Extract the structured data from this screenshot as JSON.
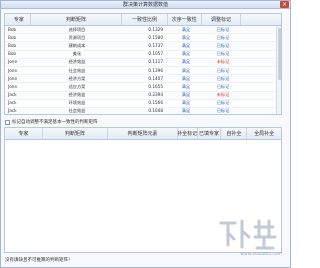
{
  "window": {
    "title": "群决策计算数据数值",
    "close_symbol": "×"
  },
  "grid1": {
    "headers": [
      "专家",
      "判断矩阵",
      "一致性比例",
      "次序一致性",
      "调整标记"
    ],
    "rows": [
      {
        "expert": "Bob",
        "matrix": "选择项目",
        "ratio": "0.1329",
        "order": "满足",
        "mark": "已标记"
      },
      {
        "expert": "Bob",
        "matrix": "资源项目",
        "ratio": "0.1580",
        "order": "满足",
        "mark": "已标记"
      },
      {
        "expert": "Bob",
        "matrix": "建筑成本",
        "ratio": "0.1737",
        "order": "满足",
        "mark": "已标记"
      },
      {
        "expert": "Bob",
        "matrix": "美化",
        "ratio": "0.1057",
        "order": "满足",
        "mark": "已标记"
      },
      {
        "expert": "Jone",
        "matrix": "经济效益",
        "ratio": "0.1117",
        "order": "满足",
        "mark": "未标记"
      },
      {
        "expert": "Jone",
        "matrix": "社会效益",
        "ratio": "0.1396",
        "order": "满足",
        "mark": "已标记"
      },
      {
        "expert": "Jone",
        "matrix": "经济方案",
        "ratio": "0.1407",
        "order": "满足",
        "mark": "已标记"
      },
      {
        "expert": "Jone",
        "matrix": "适应方案",
        "ratio": "0.1655",
        "order": "满足",
        "mark": "已标记"
      },
      {
        "expert": "Jack",
        "matrix": "经济效益",
        "ratio": "0.2394",
        "order": "满足",
        "mark": "未标记"
      },
      {
        "expert": "Jack",
        "matrix": "环境效益",
        "ratio": "0.1566",
        "order": "满足",
        "mark": "已标记"
      },
      {
        "expert": "Jack",
        "matrix": "社会效益",
        "ratio": "0.1048",
        "order": "满足",
        "mark": "已标记"
      }
    ]
  },
  "checkbox": {
    "label": "标记自动调整不满足基本一致性的判断矩阵"
  },
  "grid2": {
    "headers": [
      "专家",
      "判断矩阵",
      "判断矩阵元素",
      "补全标记",
      "已填专家",
      "自补全",
      "全局补全"
    ]
  },
  "footer": {
    "text": "没有填缺且不可推算的判断矩阵！"
  },
  "watermark": {
    "site": "www.xiazaiba.com"
  },
  "colors": {
    "link_blue": "#2563c7",
    "status_red": "#d0342c",
    "header_bg": "#e3ebf5"
  }
}
